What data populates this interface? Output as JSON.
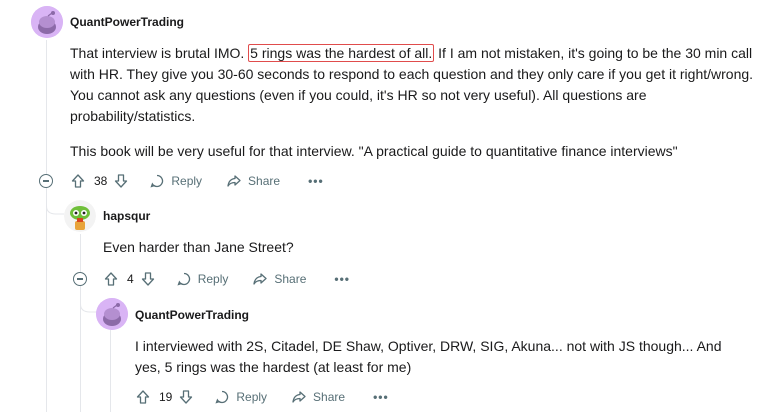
{
  "comments": [
    {
      "username": "QuantPowerTrading",
      "text_before": "That interview is brutal IMO.",
      "text_highlight": "5 rings was the hardest of all.",
      "text_after": "If I am not mistaken, it's going to be the 30 min call with HR. They give you 30-60 seconds to respond to each question and they only care if you get it right/wrong. You cannot ask any questions (even if you could, it's HR so not very useful). All questions are probability/statistics.",
      "text_para2": "This book will be very useful for that interview. \"A practical guide to quantitative finance interviews\"",
      "votes": "38",
      "reply_label": "Reply",
      "share_label": "Share",
      "more_label": "•••"
    },
    {
      "username": "hapsqur",
      "text": "Even harder than Jane Street?",
      "votes": "4",
      "reply_label": "Reply",
      "share_label": "Share",
      "more_label": "•••"
    },
    {
      "username": "QuantPowerTrading",
      "text": "I interviewed with 2S, Citadel, DE Shaw, Optiver, DRW, SIG, Akuna... not with JS though... And yes, 5 rings was the hardest (at least for me)",
      "votes": "19",
      "reply_label": "Reply",
      "share_label": "Share",
      "more_label": "•••"
    }
  ],
  "colors": {
    "highlight_border": "#e04c4c",
    "action_text": "#576f76",
    "avatar_bg": "#d9b4f5"
  },
  "icons": [
    "snoo-avatar-icon",
    "upvote-icon",
    "downvote-icon",
    "comment-icon",
    "share-icon",
    "collapse-icon",
    "more-icon"
  ]
}
